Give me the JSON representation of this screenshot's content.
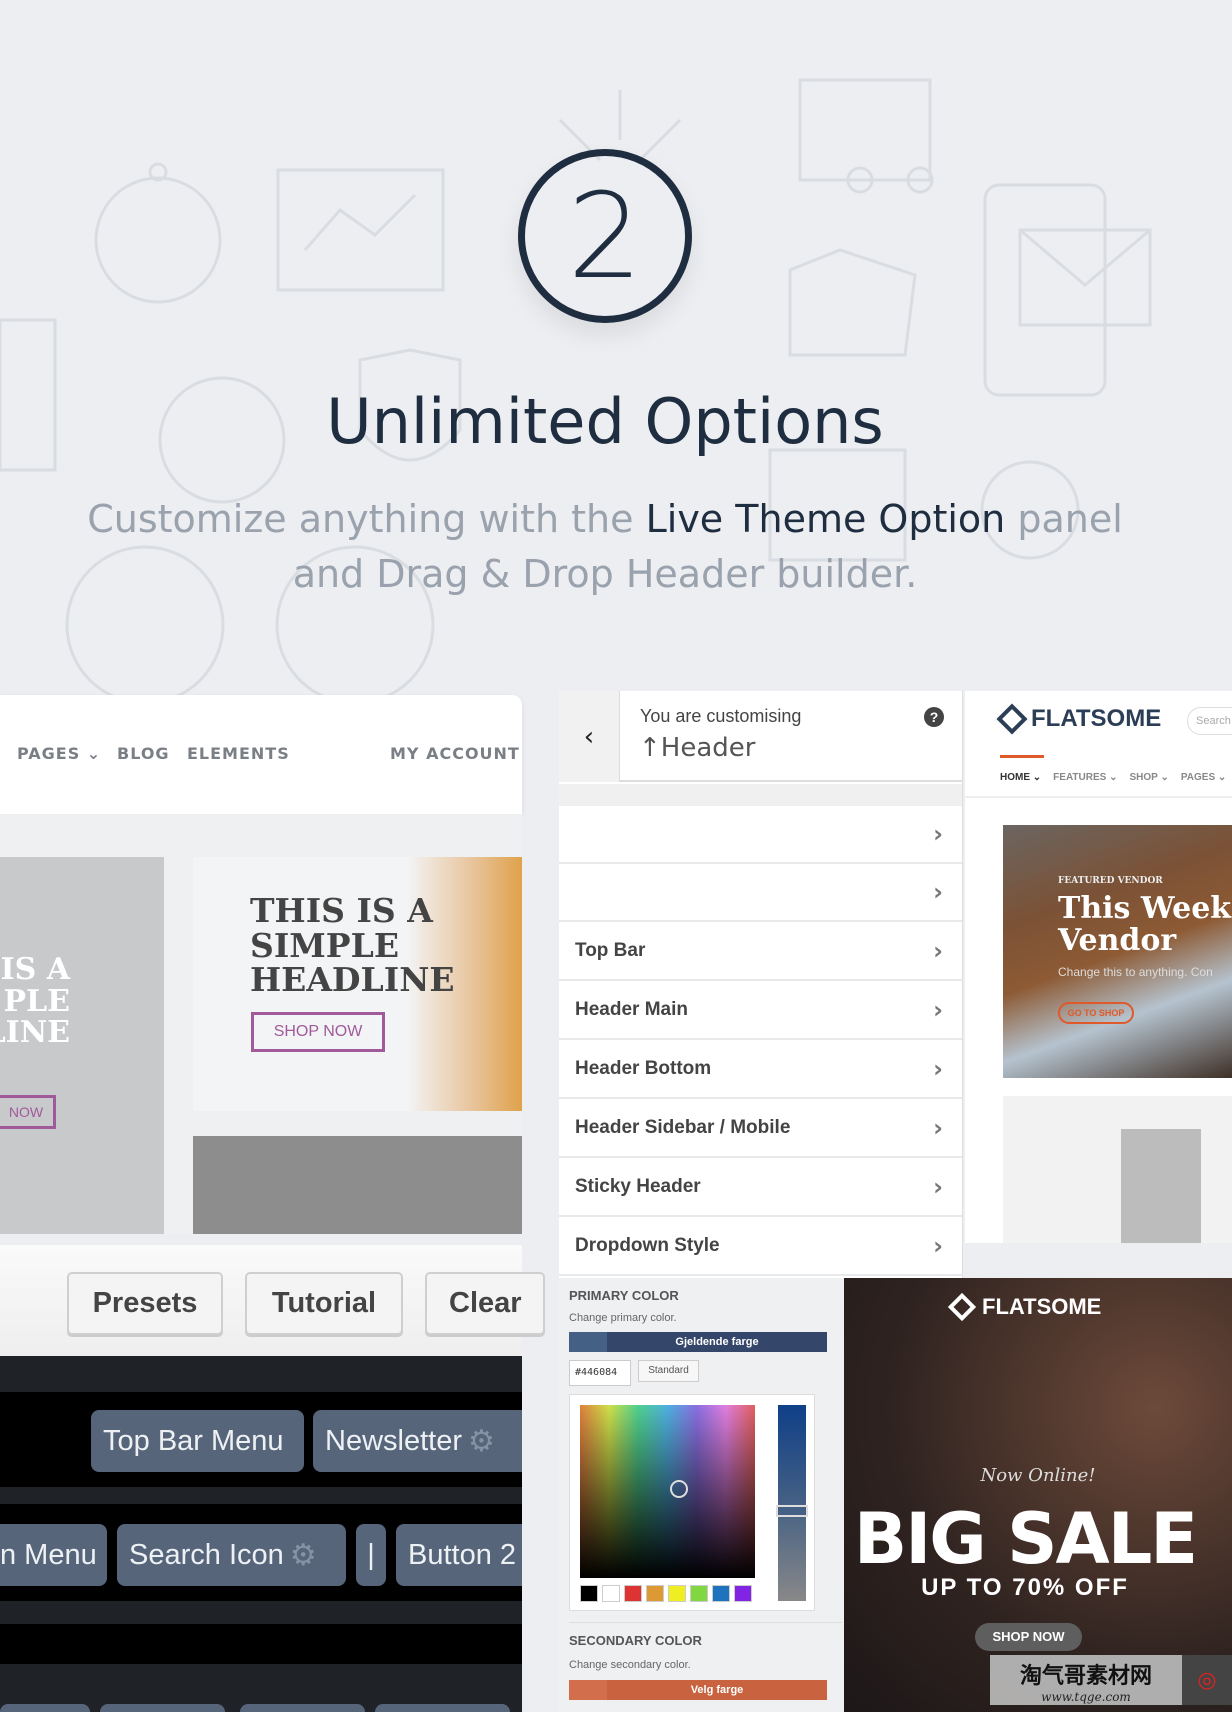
{
  "hero": {
    "step_number": "2",
    "title": "Unlimited Options",
    "subtitle_pre": "Customize anything with the ",
    "subtitle_highlight": "Live Theme Option",
    "subtitle_post": " panel",
    "subtitle_line2": "and Drag & Drop Header builder."
  },
  "left_site": {
    "nav": [
      "PAGES",
      "BLOG",
      "ELEMENTS"
    ],
    "account": "MY ACCOUNT",
    "card_partial_headline": "IS A\nPLE\nLINE",
    "card_partial_button": "NOW",
    "card_headline": "THIS IS A\nSIMPLE\nHEADLINE",
    "card_button": "SHOP NOW",
    "accent": "#a05a9c"
  },
  "builder": {
    "buttons": [
      "Presets",
      "Tutorial",
      "Clear"
    ],
    "row1": [
      "Top Bar Menu",
      "Newsletter"
    ],
    "row2": [
      "n Menu",
      "Search Icon",
      "|",
      "Button 2"
    ]
  },
  "customizer": {
    "context": "You are customising",
    "section": "Header",
    "items": [
      "",
      "",
      "Top Bar",
      "Header Main",
      "Header Bottom",
      "Header Sidebar / Mobile",
      "Sticky Header",
      "Dropdown Style"
    ]
  },
  "preview": {
    "logo": "FLATSOME",
    "search_placeholder": "Search",
    "nav": [
      "HOME",
      "FEATURES",
      "SHOP",
      "PAGES"
    ],
    "vendor_label": "FEATURED VENDOR",
    "vendor_title": "This Week F\nVendor",
    "vendor_text": "Change this to anything. Con",
    "vendor_button": "GO TO SHOP",
    "accent": "#e0592a"
  },
  "color_panel": {
    "primary_label": "PRIMARY COLOR",
    "primary_desc": "Change primary color.",
    "primary_button": "Gjeldende farge",
    "hex_value": "#446084",
    "default_button": "Standard",
    "swatches": [
      "#000000",
      "#ffffff",
      "#dd3333",
      "#dd9933",
      "#eeee22",
      "#81d742",
      "#1e73be",
      "#8224e3"
    ],
    "secondary_label": "SECONDARY COLOR",
    "secondary_desc": "Change secondary color.",
    "secondary_button": "Velg farge",
    "primary_color": "#446084",
    "secondary_color": "#d26e4b"
  },
  "banner": {
    "logo": "FLATSOME",
    "kicker": "Now Online!",
    "headline": "BIG SALE",
    "subline": "UP TO 70% OFF",
    "button": "SHOP NOW"
  },
  "watermark": {
    "text": "淘气哥素材网",
    "url": "www.tqge.com"
  }
}
